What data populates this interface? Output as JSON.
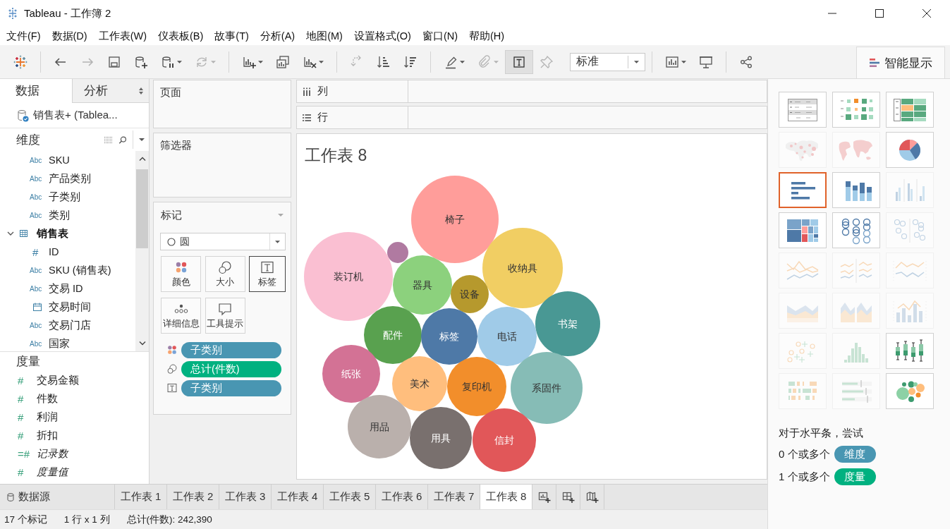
{
  "window": {
    "title": "Tableau - 工作簿 2"
  },
  "menu": [
    "文件(F)",
    "数据(D)",
    "工作表(W)",
    "仪表板(B)",
    "故事(T)",
    "分析(A)",
    "地图(M)",
    "设置格式(O)",
    "窗口(N)",
    "帮助(H)"
  ],
  "toolbar": [
    [
      {
        "kind": "logo",
        "disabled": false,
        "menu": false,
        "pressed": false
      }
    ],
    [
      {
        "kind": "undo",
        "disabled": false,
        "menu": false,
        "pressed": false
      },
      {
        "kind": "redo",
        "disabled": true,
        "menu": false,
        "pressed": false
      },
      {
        "kind": "save",
        "disabled": false,
        "menu": false,
        "pressed": false
      },
      {
        "kind": "newds",
        "disabled": false,
        "menu": false,
        "pressed": false
      },
      {
        "kind": "pause",
        "disabled": false,
        "menu": true,
        "pressed": false
      },
      {
        "kind": "refresh",
        "disabled": true,
        "menu": true,
        "pressed": false
      }
    ],
    [
      {
        "kind": "newsheet",
        "disabled": false,
        "menu": true,
        "pressed": false
      },
      {
        "kind": "duplicate",
        "disabled": false,
        "menu": false,
        "pressed": false
      },
      {
        "kind": "clear",
        "disabled": false,
        "menu": true,
        "pressed": false
      }
    ],
    [
      {
        "kind": "swap",
        "disabled": true,
        "menu": false,
        "pressed": false
      },
      {
        "kind": "sortasc",
        "disabled": false,
        "menu": false,
        "pressed": false
      },
      {
        "kind": "sortdesc",
        "disabled": false,
        "menu": false,
        "pressed": false
      }
    ],
    [
      {
        "kind": "highlight",
        "disabled": false,
        "menu": true,
        "pressed": false
      },
      {
        "kind": "group",
        "disabled": true,
        "menu": true,
        "pressed": false
      },
      {
        "kind": "labels",
        "disabled": false,
        "menu": false,
        "pressed": true
      },
      {
        "kind": "pin",
        "disabled": true,
        "menu": false,
        "pressed": false
      },
      {
        "kind": "fit",
        "value": "标准",
        "disabled": false,
        "menu": true,
        "pressed": false
      }
    ],
    [
      {
        "kind": "cards",
        "disabled": false,
        "menu": true,
        "pressed": false
      },
      {
        "kind": "present",
        "disabled": false,
        "menu": false,
        "pressed": false
      }
    ],
    [
      {
        "kind": "share",
        "disabled": false,
        "menu": false,
        "pressed": false
      }
    ]
  ],
  "showme_tab": {
    "label": "智能显示",
    "selected": true
  },
  "data_pane": {
    "tabs": [
      {
        "label": "数据",
        "selected": true
      },
      {
        "label": "分析",
        "selected": false
      }
    ],
    "datasource": "销售表+ (Tablea...",
    "dimensions": {
      "title": "维度",
      "fields": [
        {
          "kind": "text",
          "badge": "Abc",
          "name": "SKU"
        },
        {
          "kind": "text",
          "badge": "Abc",
          "name": "产品类别"
        },
        {
          "kind": "text",
          "badge": "Abc",
          "name": "子类别"
        },
        {
          "kind": "text",
          "badge": "Abc",
          "name": "类别"
        },
        {
          "kind": "table",
          "name": "销售表",
          "expanded": true,
          "children": [
            {
              "kind": "number",
              "badge": "#",
              "name": "ID"
            },
            {
              "kind": "text",
              "badge": "Abc",
              "name": "SKU (销售表)"
            },
            {
              "kind": "text",
              "badge": "Abc",
              "name": "交易 ID"
            },
            {
              "kind": "date",
              "name": "交易时间"
            },
            {
              "kind": "text",
              "badge": "Abc",
              "name": "交易门店"
            },
            {
              "kind": "text",
              "badge": "Abc",
              "name": "国家"
            }
          ]
        }
      ]
    },
    "measures": {
      "title": "度量",
      "fields": [
        {
          "badge": "#",
          "name": "交易金额",
          "generated": false
        },
        {
          "badge": "#",
          "name": "件数",
          "generated": false
        },
        {
          "badge": "#",
          "name": "利润",
          "generated": false
        },
        {
          "badge": "#",
          "name": "折扣",
          "generated": false
        },
        {
          "badge": "=#",
          "name": "记录数",
          "generated": true
        },
        {
          "badge": "#",
          "name": "度量值",
          "generated": true
        }
      ]
    }
  },
  "shelves": {
    "pages": "页面",
    "filters": "筛选器",
    "columns": "列",
    "rows": "行"
  },
  "marks": {
    "title": "标记",
    "mark_type": "圆",
    "buttons": [
      {
        "kind": "color",
        "label": "颜色",
        "selected": false
      },
      {
        "kind": "size",
        "label": "大小",
        "selected": false
      },
      {
        "kind": "label",
        "label": "标签",
        "selected": true
      },
      {
        "kind": "detail",
        "label": "详细信息",
        "selected": false
      },
      {
        "kind": "tooltip",
        "label": "工具提示",
        "selected": false
      }
    ],
    "pills": [
      {
        "kind": "color",
        "label": "子类别",
        "continuous": false
      },
      {
        "kind": "size",
        "label": "总计(件数)",
        "continuous": true
      },
      {
        "kind": "label",
        "label": "子类别",
        "continuous": false
      }
    ]
  },
  "view": {
    "title": "工作表 8",
    "bubbles": [
      {
        "label": "椅子",
        "color": "#ff9d9a"
      },
      {
        "color": "#b07aa1"
      },
      {
        "label": "装订机",
        "color": "#fabfd2"
      },
      {
        "label": "收纳具",
        "color": "#f1ce63"
      },
      {
        "label": "器具",
        "color": "#8cd17d"
      },
      {
        "label": "设备",
        "color": "#b6992d"
      },
      {
        "label": "书架",
        "color": "#499894"
      },
      {
        "label": "配件",
        "color": "#59a14f"
      },
      {
        "label": "标签",
        "color": "#4e79a7"
      },
      {
        "label": "电话",
        "color": "#a0cbe8"
      },
      {
        "label": "纸张",
        "color": "#d37295"
      },
      {
        "label": "美术",
        "color": "#ffbe7d"
      },
      {
        "label": "复印机",
        "color": "#f28e2b"
      },
      {
        "label": "系固件",
        "color": "#86bcb6"
      },
      {
        "label": "用品",
        "color": "#bab0ac"
      },
      {
        "label": "用具",
        "color": "#79706e"
      },
      {
        "label": "信封",
        "color": "#e15759"
      }
    ]
  },
  "showme": {
    "charts": [
      {
        "kind": "table",
        "selected": false,
        "disabled": false
      },
      {
        "kind": "heatmap",
        "selected": false,
        "disabled": false
      },
      {
        "kind": "highlight",
        "selected": false,
        "disabled": false
      },
      {
        "kind": "symbolmap",
        "selected": false,
        "disabled": true
      },
      {
        "kind": "filledmap",
        "selected": false,
        "disabled": true
      },
      {
        "kind": "pie",
        "selected": false,
        "disabled": false
      },
      {
        "kind": "hbar",
        "selected": true,
        "disabled": false
      },
      {
        "kind": "stackedbar",
        "selected": false,
        "disabled": false
      },
      {
        "kind": "sidebar",
        "selected": false,
        "disabled": true
      },
      {
        "kind": "treemap",
        "selected": false,
        "disabled": false
      },
      {
        "kind": "circles",
        "selected": false,
        "disabled": false
      },
      {
        "kind": "sidecircles",
        "selected": false,
        "disabled": true
      },
      {
        "kind": "line",
        "selected": false,
        "disabled": true
      },
      {
        "kind": "linediscrete",
        "selected": false,
        "disabled": true
      },
      {
        "kind": "dualline",
        "selected": false,
        "disabled": true
      },
      {
        "kind": "area",
        "selected": false,
        "disabled": true
      },
      {
        "kind": "areadiscrete",
        "selected": false,
        "disabled": true
      },
      {
        "kind": "combo",
        "selected": false,
        "disabled": true
      },
      {
        "kind": "scatter",
        "selected": false,
        "disabled": true
      },
      {
        "kind": "histogram",
        "selected": false,
        "disabled": true
      },
      {
        "kind": "boxplot",
        "selected": false,
        "disabled": false
      },
      {
        "kind": "gantt",
        "selected": false,
        "disabled": true
      },
      {
        "kind": "bullet",
        "selected": false,
        "disabled": true
      },
      {
        "kind": "bubbles",
        "selected": false,
        "disabled": false
      }
    ],
    "hint": "对于水平条，尝试",
    "requirements": [
      {
        "count": "0 个或多个",
        "pill": "维度",
        "kind": "dimension"
      },
      {
        "count": "1 个或多个",
        "pill": "度量",
        "kind": "measure"
      }
    ]
  },
  "sheet_tabs": {
    "datasource": "数据源",
    "sheets": [
      {
        "label": "工作表 1",
        "selected": false
      },
      {
        "label": "工作表 2",
        "selected": false
      },
      {
        "label": "工作表 3",
        "selected": false
      },
      {
        "label": "工作表 4",
        "selected": false
      },
      {
        "label": "工作表 5",
        "selected": false
      },
      {
        "label": "工作表 6",
        "selected": false
      },
      {
        "label": "工作表 7",
        "selected": false
      },
      {
        "label": "工作表 8",
        "selected": true
      }
    ],
    "actions": [
      {
        "kind": "worksheet"
      },
      {
        "kind": "dashboard"
      },
      {
        "kind": "story"
      }
    ]
  },
  "status_bar": [
    "17 个标记",
    "1 行 x 1 列",
    "总计(件数): 242,390"
  ]
}
